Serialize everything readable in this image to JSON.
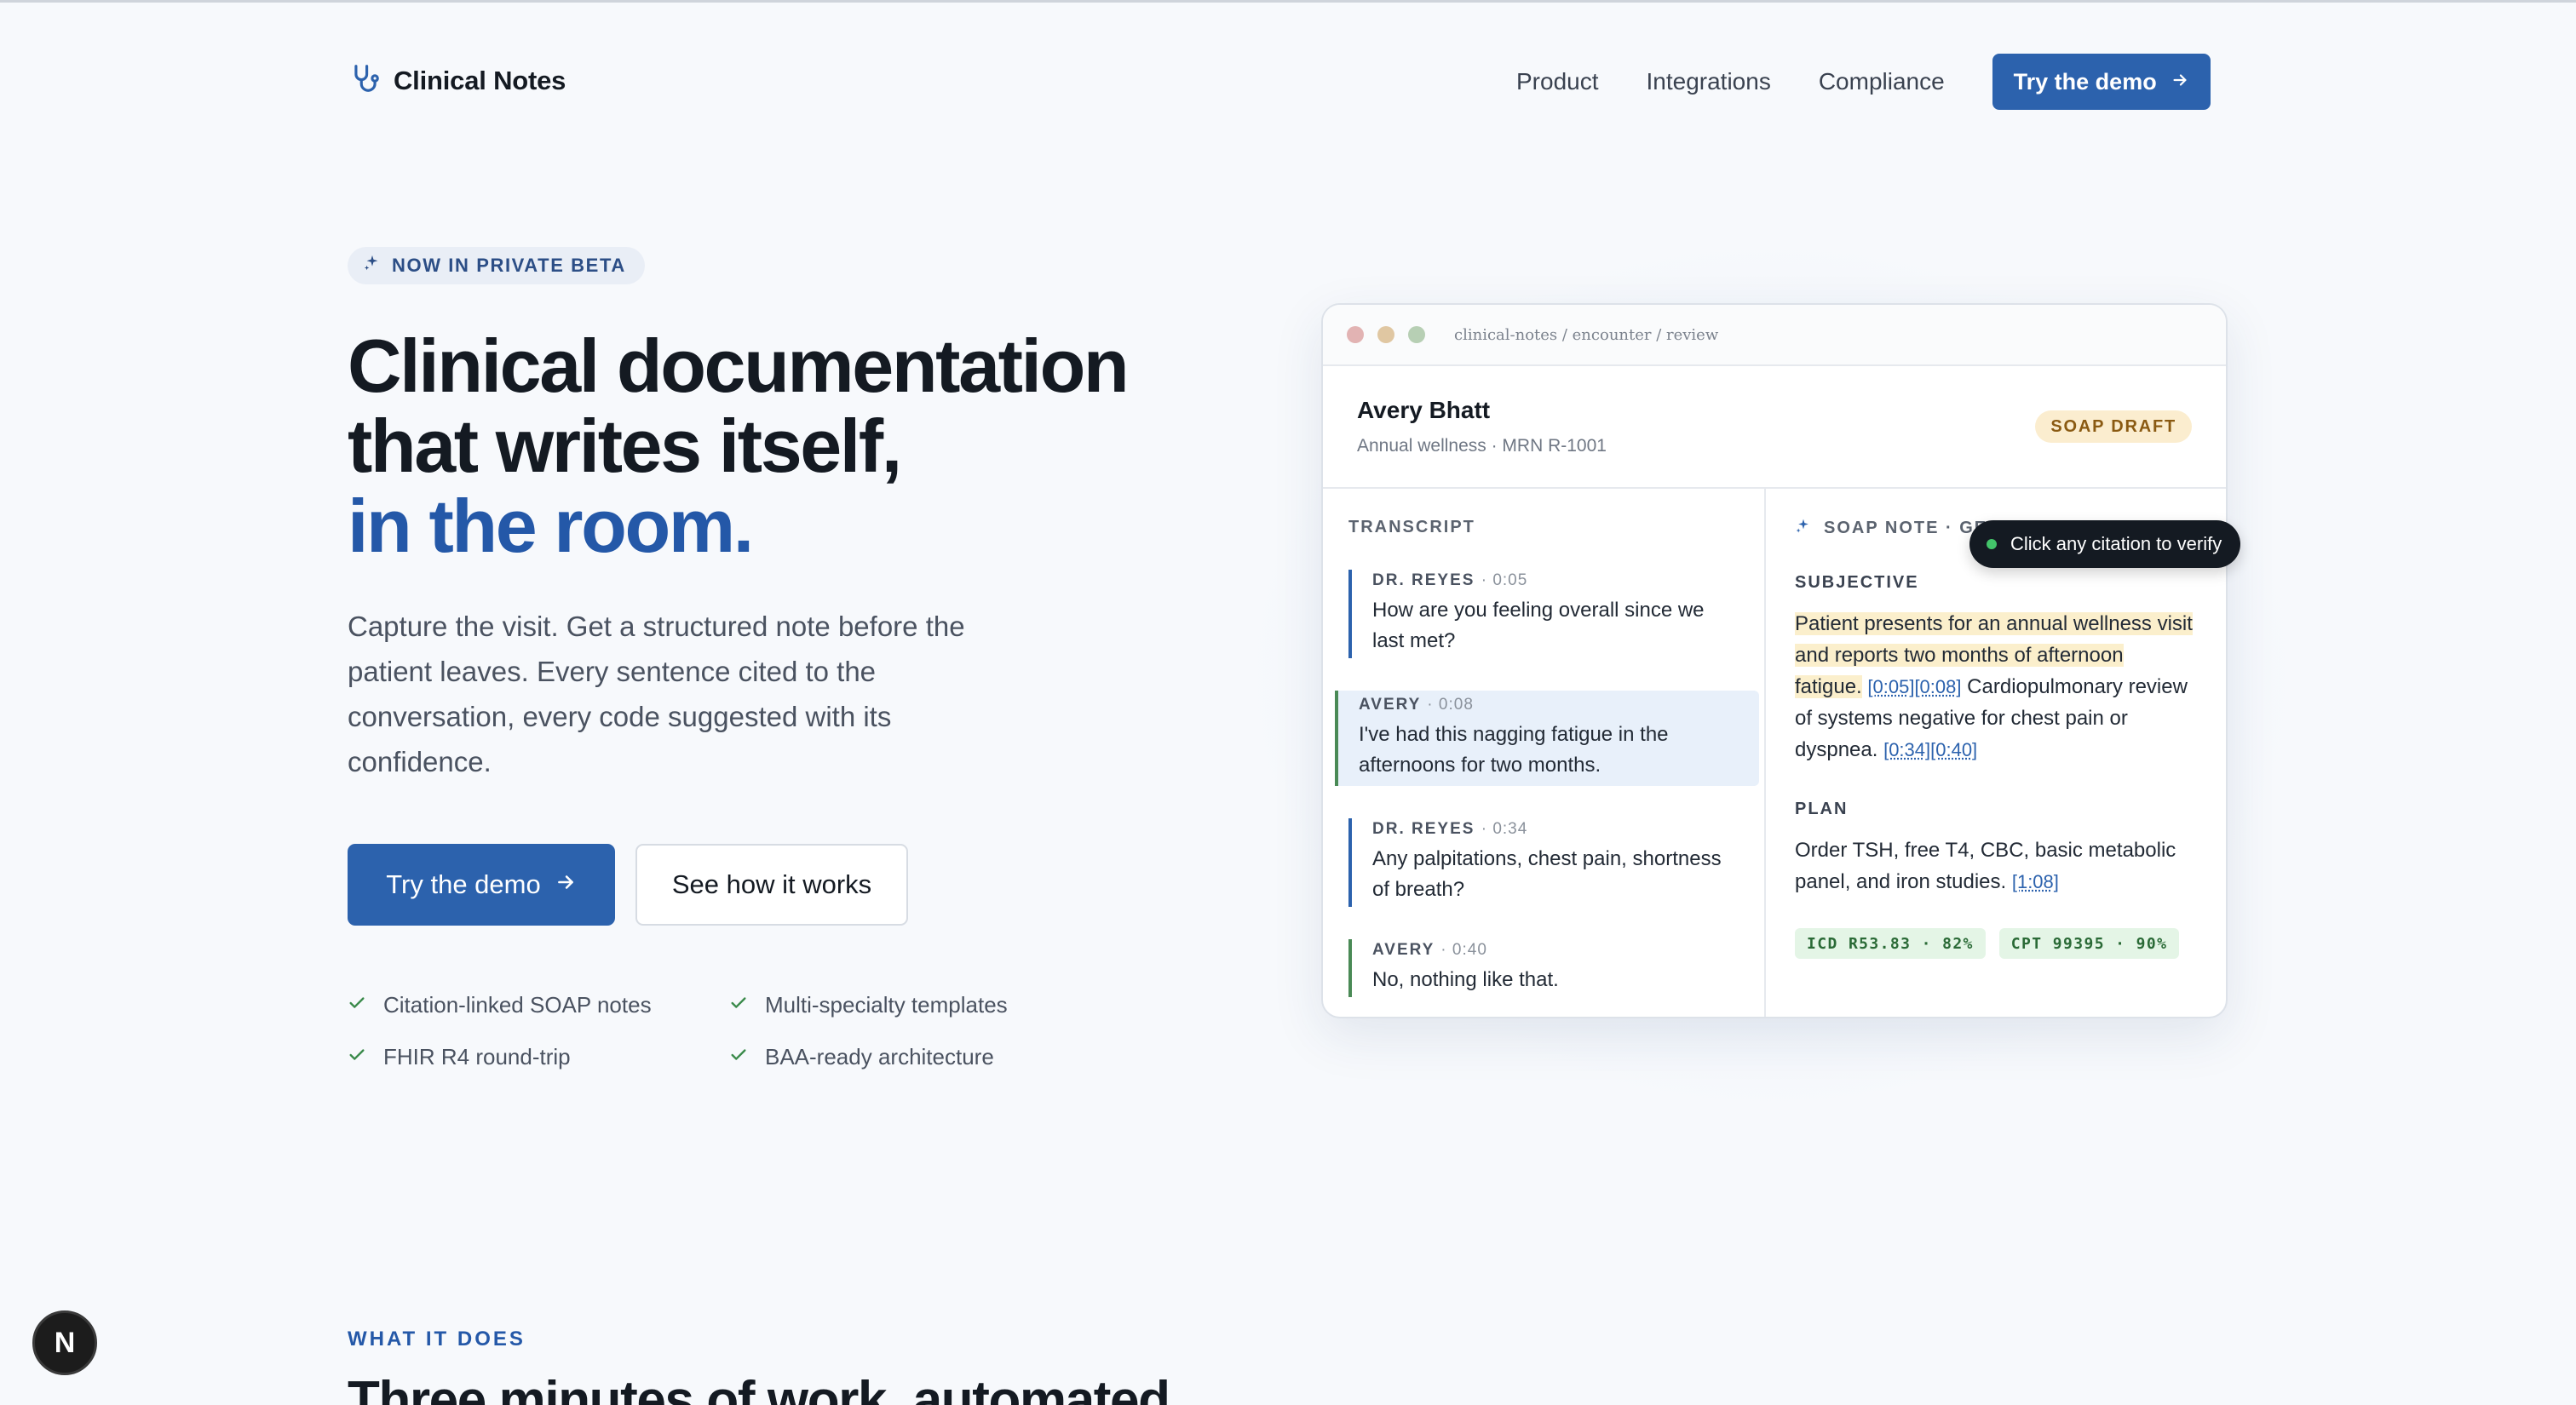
{
  "brand": {
    "name": "Clinical Notes",
    "icon": "stethoscope-icon"
  },
  "nav": {
    "links": [
      "Product",
      "Integrations",
      "Compliance"
    ],
    "cta_label": "Try the demo"
  },
  "hero": {
    "badge": "NOW IN PRIVATE BETA",
    "title_line1": "Clinical documentation",
    "title_line2": "that writes itself,",
    "title_accent": "in the room.",
    "subtitle": "Capture the visit. Get a structured note before the patient leaves. Every sentence cited to the conversation, every code suggested with its confidence.",
    "primary_cta": "Try the demo",
    "secondary_cta": "See how it works",
    "features": [
      "Citation-linked SOAP notes",
      "Multi-specialty templates",
      "FHIR R4 round-trip",
      "BAA-ready architecture"
    ]
  },
  "preview": {
    "path": "clinical-notes / encounter / review",
    "dot_colors": [
      "#e2b3b3",
      "#e0c7a2",
      "#b7cfb4"
    ],
    "patient_name": "Avery Bhatt",
    "patient_meta": "Annual wellness · MRN R-1001",
    "status_badge": "SOAP DRAFT",
    "transcript_label": "TRANSCRIPT",
    "transcript": [
      {
        "speaker": "DR. REYES",
        "time": "0:05",
        "text": "How are you feeling overall since we last met?"
      },
      {
        "speaker": "AVERY",
        "time": "0:08",
        "text": "I've had this nagging fatigue in the afternoons for two months."
      },
      {
        "speaker": "DR. REYES",
        "time": "0:34",
        "text": "Any palpitations, chest pain, shortness of breath?"
      },
      {
        "speaker": "AVERY",
        "time": "0:40",
        "text": "No, nothing like that."
      }
    ],
    "soap_label": "SOAP NOTE · GE",
    "tooltip": "Click any citation to verify",
    "subjective_label": "SUBJECTIVE",
    "subjective_hl": "Patient presents for an annual wellness visit and reports two months of afternoon fatigue.",
    "subjective_cite1": "[0:05][0:08]",
    "subjective_rest": "Cardiopulmonary review of systems negative for chest pain or dyspnea.",
    "subjective_cite2": "[0:34][0:40]",
    "plan_label": "PLAN",
    "plan_text": "Order TSH, free T4, CBC, basic metabolic panel, and iron studies.",
    "plan_cite": "[1:08]",
    "codes": [
      "ICD R53.83 · 82%",
      "CPT 99395 · 90%"
    ]
  },
  "section": {
    "kicker": "WHAT IT DOES",
    "heading": "Three minutes of work, automated"
  },
  "floating_badge": "N"
}
